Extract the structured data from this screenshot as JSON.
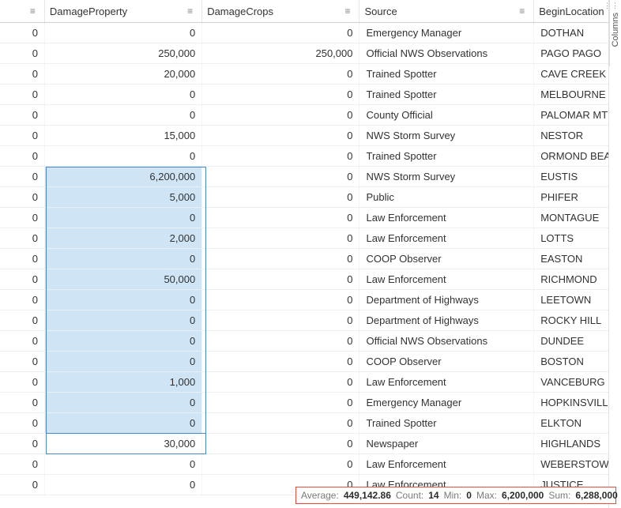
{
  "icons": {
    "menu": "≡"
  },
  "columns": [
    {
      "key": "blank",
      "label": ""
    },
    {
      "key": "DamageProperty",
      "label": "DamageProperty"
    },
    {
      "key": "DamageCrops",
      "label": "DamageCrops"
    },
    {
      "key": "Source",
      "label": "Source"
    },
    {
      "key": "BeginLocation",
      "label": "BeginLocation"
    }
  ],
  "sideTab": {
    "label": "Columns"
  },
  "selection": {
    "col": 1,
    "startRow": 7,
    "endRow": 19
  },
  "status": {
    "averageLabel": "Average:",
    "average": "449,142.86",
    "countLabel": "Count:",
    "count": "14",
    "minLabel": "Min:",
    "min": "0",
    "maxLabel": "Max:",
    "max": "6,200,000",
    "sumLabel": "Sum:",
    "sum": "6,288,000"
  },
  "rows": [
    {
      "c0": "0",
      "c1": "0",
      "c2": "0",
      "c3": "Emergency Manager",
      "c4": "DOTHAN"
    },
    {
      "c0": "0",
      "c1": "250,000",
      "c2": "250,000",
      "c3": "Official NWS Observations",
      "c4": "PAGO PAGO"
    },
    {
      "c0": "0",
      "c1": "20,000",
      "c2": "0",
      "c3": "Trained Spotter",
      "c4": "CAVE CREEK"
    },
    {
      "c0": "0",
      "c1": "0",
      "c2": "0",
      "c3": "Trained Spotter",
      "c4": "MELBOURNE BE"
    },
    {
      "c0": "0",
      "c1": "0",
      "c2": "0",
      "c3": "County Official",
      "c4": "PALOMAR MTN"
    },
    {
      "c0": "0",
      "c1": "15,000",
      "c2": "0",
      "c3": "NWS Storm Survey",
      "c4": "NESTOR"
    },
    {
      "c0": "0",
      "c1": "0",
      "c2": "0",
      "c3": "Trained Spotter",
      "c4": "ORMOND BEAC"
    },
    {
      "c0": "0",
      "c1": "6,200,000",
      "c2": "0",
      "c3": "NWS Storm Survey",
      "c4": "EUSTIS"
    },
    {
      "c0": "0",
      "c1": "5,000",
      "c2": "0",
      "c3": "Public",
      "c4": "PHIFER"
    },
    {
      "c0": "0",
      "c1": "0",
      "c2": "0",
      "c3": "Law Enforcement",
      "c4": "MONTAGUE"
    },
    {
      "c0": "0",
      "c1": "2,000",
      "c2": "0",
      "c3": "Law Enforcement",
      "c4": "LOTTS"
    },
    {
      "c0": "0",
      "c1": "0",
      "c2": "0",
      "c3": "COOP Observer",
      "c4": "EASTON"
    },
    {
      "c0": "0",
      "c1": "50,000",
      "c2": "0",
      "c3": "Law Enforcement",
      "c4": "RICHMOND"
    },
    {
      "c0": "0",
      "c1": "0",
      "c2": "0",
      "c3": "Department of Highways",
      "c4": "LEETOWN"
    },
    {
      "c0": "0",
      "c1": "0",
      "c2": "0",
      "c3": "Department of Highways",
      "c4": "ROCKY HILL"
    },
    {
      "c0": "0",
      "c1": "0",
      "c2": "0",
      "c3": "Official NWS Observations",
      "c4": "DUNDEE"
    },
    {
      "c0": "0",
      "c1": "0",
      "c2": "0",
      "c3": "COOP Observer",
      "c4": "BOSTON"
    },
    {
      "c0": "0",
      "c1": "1,000",
      "c2": "0",
      "c3": "Law Enforcement",
      "c4": "VANCEBURG"
    },
    {
      "c0": "0",
      "c1": "0",
      "c2": "0",
      "c3": "Emergency Manager",
      "c4": "HOPKINSVILLE A"
    },
    {
      "c0": "0",
      "c1": "0",
      "c2": "0",
      "c3": "Trained Spotter",
      "c4": "ELKTON"
    },
    {
      "c0": "0",
      "c1": "30,000",
      "c2": "0",
      "c3": "Newspaper",
      "c4": "HIGHLANDS"
    },
    {
      "c0": "0",
      "c1": "0",
      "c2": "0",
      "c3": "Law Enforcement",
      "c4": "WEBERSTOWN"
    },
    {
      "c0": "0",
      "c1": "0",
      "c2": "0",
      "c3": "Law Enforcement",
      "c4": "JUSTICE"
    }
  ]
}
